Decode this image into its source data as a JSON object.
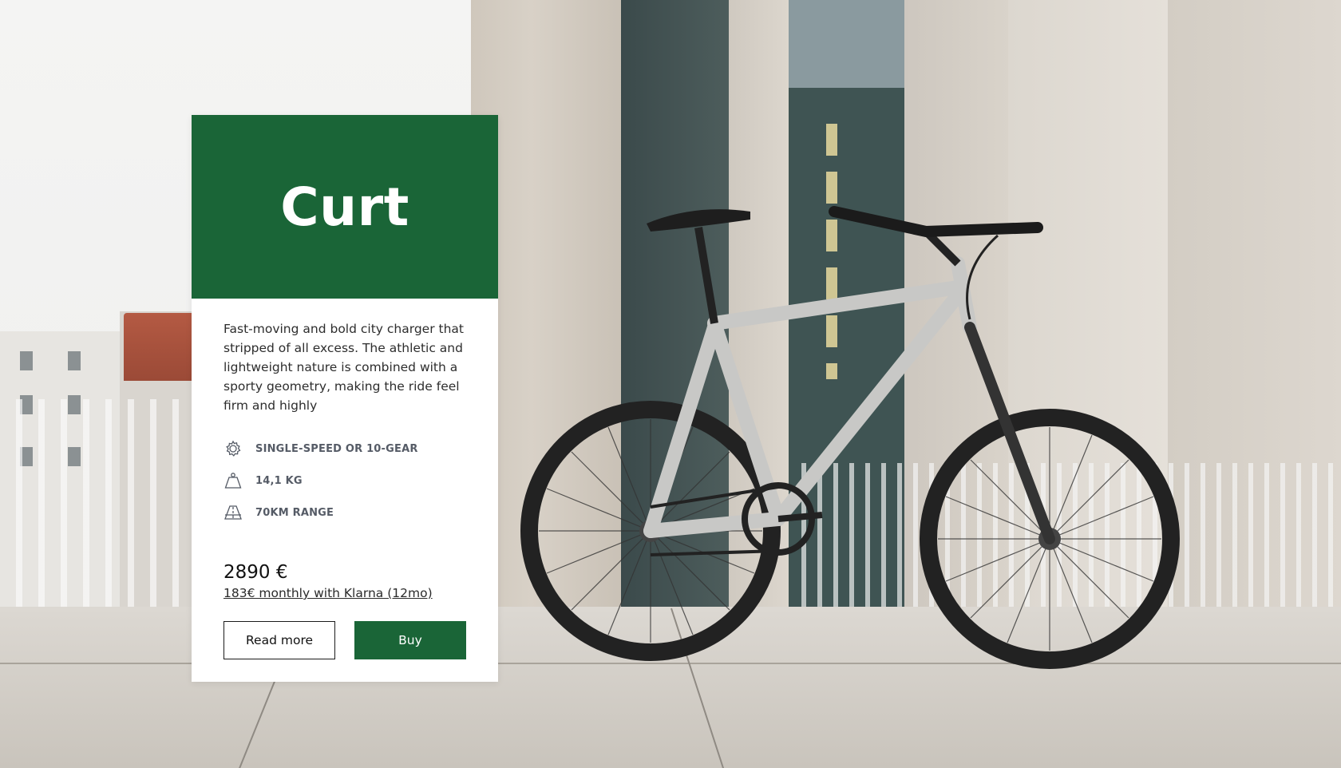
{
  "product": {
    "name": "Curt",
    "description": "Fast-moving and bold city charger that stripped of all excess. The athletic and lightweight nature is combined with a sporty geometry, making the ride feel firm and highly",
    "specs": [
      {
        "icon": "gear-icon",
        "label": "SINGLE-SPEED OR 10-GEAR"
      },
      {
        "icon": "weight-icon",
        "label": "14,1 KG"
      },
      {
        "icon": "road-icon",
        "label": "70KM RANGE"
      }
    ],
    "price": "2890 €",
    "financing": "183€ monthly with Klarna (12mo)"
  },
  "actions": {
    "read_more_label": "Read more",
    "buy_label": "Buy"
  },
  "colors": {
    "brand_green": "#1a6537",
    "card_bg": "#ffffff",
    "text_dark": "#2d2d2d",
    "spec_text": "#555b66"
  }
}
